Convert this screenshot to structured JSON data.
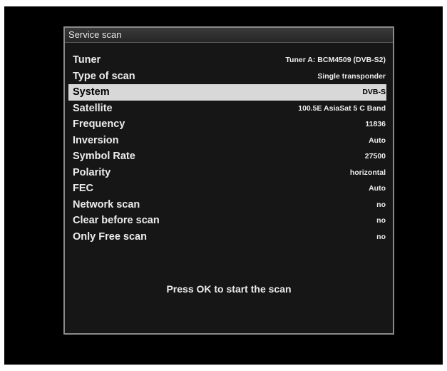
{
  "dialog": {
    "title": "Service scan",
    "hint": "Press OK to start the scan"
  },
  "options": [
    {
      "label": "Tuner",
      "value": "Tuner A: BCM4509 (DVB-S2)",
      "selected": false
    },
    {
      "label": "Type of scan",
      "value": "Single transponder",
      "selected": false
    },
    {
      "label": "System",
      "value": "DVB-S",
      "selected": true
    },
    {
      "label": "Satellite",
      "value": "100.5E AsiaSat 5 C Band",
      "selected": false
    },
    {
      "label": "Frequency",
      "value": "11836",
      "selected": false
    },
    {
      "label": "Inversion",
      "value": "Auto",
      "selected": false
    },
    {
      "label": "Symbol Rate",
      "value": "27500",
      "selected": false
    },
    {
      "label": "Polarity",
      "value": "horizontal",
      "selected": false
    },
    {
      "label": "FEC",
      "value": "Auto",
      "selected": false
    },
    {
      "label": "Network scan",
      "value": "no",
      "selected": false
    },
    {
      "label": "Clear before scan",
      "value": "no",
      "selected": false
    },
    {
      "label": "Only Free scan",
      "value": "no",
      "selected": false
    }
  ],
  "colors": {
    "background": "#000000",
    "dialog": "#161616",
    "highlight": "#d8d8d8",
    "text": "#ececec"
  }
}
